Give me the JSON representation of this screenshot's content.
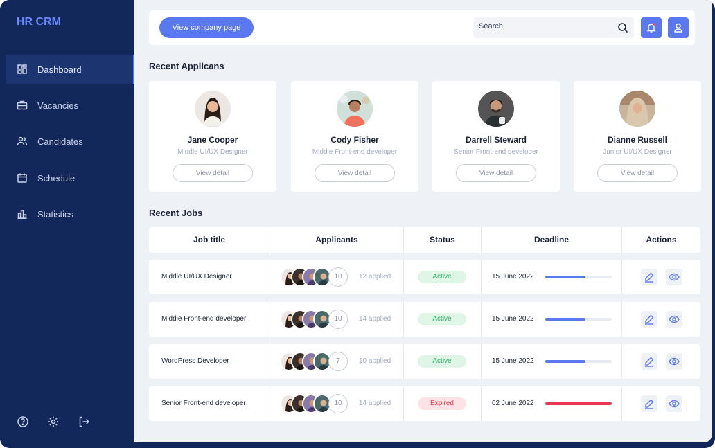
{
  "brand": "HR CRM",
  "nav": [
    {
      "label": "Dashboard",
      "icon": "dashboard-icon"
    },
    {
      "label": "Vacancies",
      "icon": "briefcase-icon"
    },
    {
      "label": "Candidates",
      "icon": "users-icon"
    },
    {
      "label": "Schedule",
      "icon": "calendar-icon"
    },
    {
      "label": "Statistics",
      "icon": "bar-chart-icon"
    }
  ],
  "bottom_icons": [
    "help-icon",
    "settings-icon",
    "logout-icon"
  ],
  "topbar": {
    "company_button": "View company page",
    "search_placeholder": "Search"
  },
  "recent_applicants": {
    "title": "Recent Applicans",
    "cards": [
      {
        "name": "Jane Cooper",
        "role": "Middle UI/UX Designer",
        "button": "View detail"
      },
      {
        "name": "Cody Fisher",
        "role": "Middle Front-end developer",
        "button": "View detail"
      },
      {
        "name": "Darrell Steward",
        "role": "Senior Front-end developer",
        "button": "View detail"
      },
      {
        "name": "Dianne Russell",
        "role": "Junior UI/UX Designer",
        "button": "View detail"
      }
    ]
  },
  "recent_jobs": {
    "title": "Recent Jobs",
    "columns": [
      "Job title",
      "Applicants",
      "Status",
      "Deadline",
      "Actions"
    ],
    "rows": [
      {
        "title": "Middle UI/UX Designer",
        "extra": "10",
        "applied": "12 applied",
        "status": "Active",
        "deadline": "15 June 2022",
        "progress": 0.6
      },
      {
        "title": "Middle Front-end developer",
        "extra": "10",
        "applied": "14 applied",
        "status": "Active",
        "deadline": "15 June 2022",
        "progress": 0.6
      },
      {
        "title": "WordPress Developer",
        "extra": "7",
        "applied": "10 applied",
        "status": "Active",
        "deadline": "15 June 2022",
        "progress": 0.6
      },
      {
        "title": "Senior Front-end developer",
        "extra": "10",
        "applied": "14 applied",
        "status": "Expired",
        "deadline": "02 June 2022",
        "progress": 1.0
      }
    ]
  },
  "colors": {
    "sidebar": "#13285a",
    "accent": "#5a78f0",
    "active_green": "#2eb464",
    "expired_red": "#e8364b"
  }
}
